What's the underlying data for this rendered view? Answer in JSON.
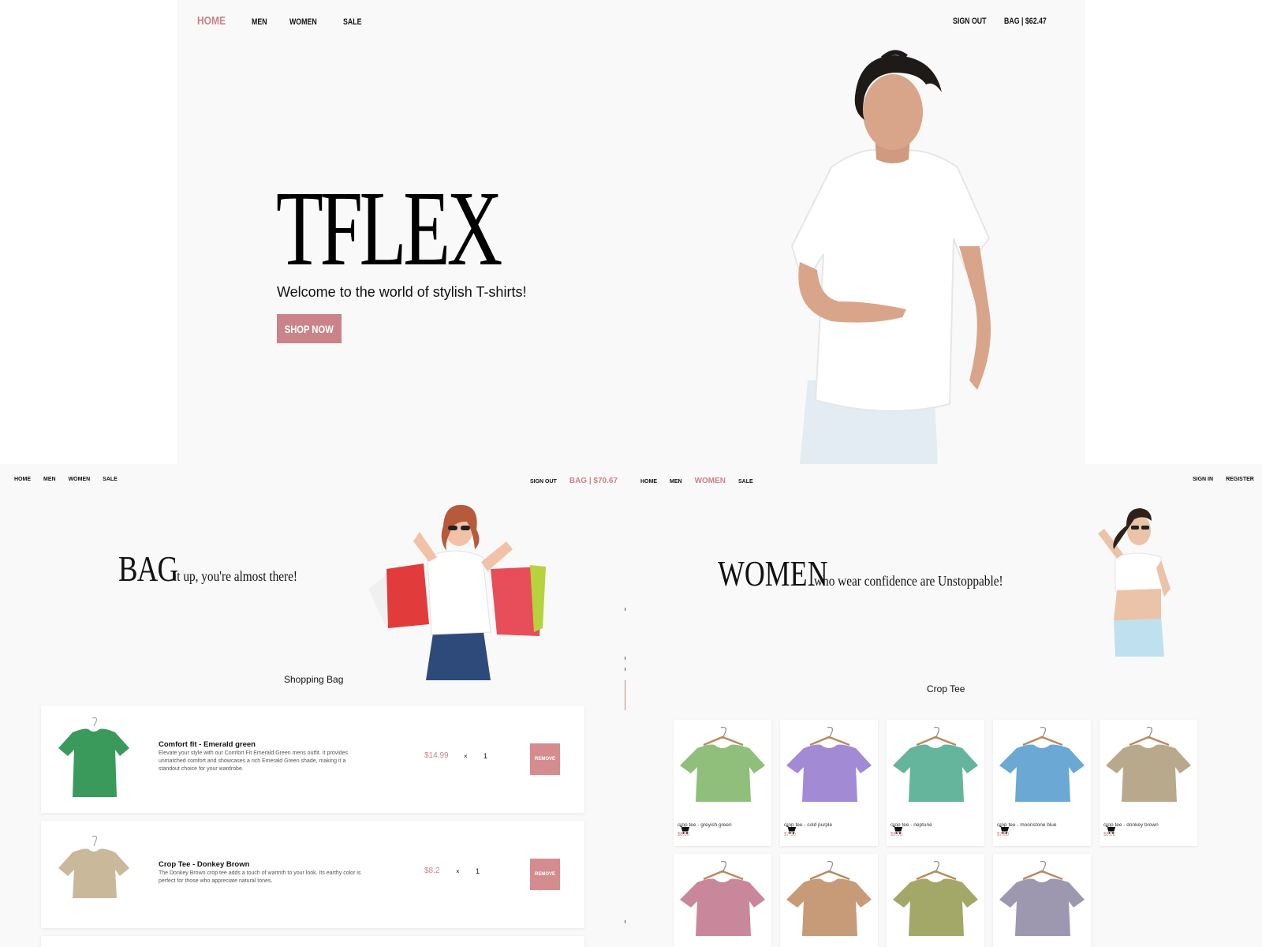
{
  "hero": {
    "nav": [
      "HOME",
      "MEN",
      "WOMEN",
      "SALE"
    ],
    "sign_out": "SIGN OUT",
    "bag": "BAG | $62.47",
    "brand": "TFLEX",
    "tagline": "Welcome to the world of stylish T-shirts!",
    "cta": "SHOP NOW"
  },
  "bag_page": {
    "nav": [
      "HOME",
      "MEN",
      "WOMEN",
      "SALE"
    ],
    "sign_out": "SIGN OUT",
    "bag": "BAG | $70.67",
    "heading_big": "BAG",
    "heading_small": "it up, you're almost there!",
    "section_title": "Shopping Bag",
    "items": [
      {
        "name": "Comfort fit - Emerald green",
        "description": "Elevate your style with our Comfort Fit Emerald Green mens outfit. It provides unmatched comfort and showcases a rich Emerald Green shade, making it a standout choice for your wardrobe.",
        "price": "$14.99",
        "times": "×",
        "qty": "1",
        "remove": "REMOVE",
        "color": "#3a9a5b"
      },
      {
        "name": "Crop Tee - Donkey Brown",
        "description": "The Donkey Brown crop tee adds a touch of warmth to your look. Its earthy color is perfect for those who appreciate natural tones.",
        "price": "$8.2",
        "times": "×",
        "qty": "1",
        "remove": "REMOVE",
        "color": "#c9b89a"
      }
    ]
  },
  "women_page": {
    "nav": [
      "HOME",
      "MEN",
      "WOMEN",
      "SALE"
    ],
    "sign_in": "SIGN IN",
    "register": "REGISTER",
    "heading_big": "WOMEN",
    "heading_small": "who wear confidence are Unstoppable!",
    "section_title": "Crop Tee",
    "products": [
      {
        "name": "crop tee - greyish green",
        "price": "$8.50",
        "color": "#8fbf7a"
      },
      {
        "name": "crop tee - cold purple",
        "price": "$7.50",
        "color": "#a28ad4"
      },
      {
        "name": "crop tee - neptune",
        "price": "$9.00",
        "color": "#64b59c"
      },
      {
        "name": "crop tee - moonstone blue",
        "price": "$7.80",
        "color": "#6ba8d4"
      },
      {
        "name": "crop tee - donkey brown",
        "price": "$8.20",
        "color": "#b9a98c"
      },
      {
        "name": "",
        "price": "",
        "color": "#c9879c"
      },
      {
        "name": "",
        "price": "",
        "color": "#c79a78"
      },
      {
        "name": "",
        "price": "",
        "color": "#a3a868"
      },
      {
        "name": "",
        "price": "",
        "color": "#9d97b0"
      }
    ]
  },
  "colors": {
    "accent": "#c98389",
    "page_bg": "#f9f9f9"
  }
}
